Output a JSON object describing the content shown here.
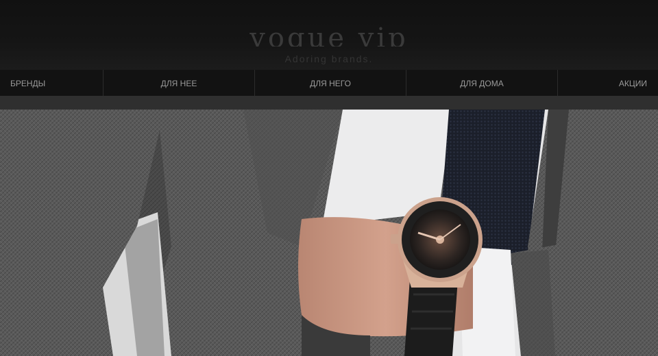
{
  "header": {
    "logo_text": "vogue vip",
    "tagline": "Adoring brands."
  },
  "nav": {
    "items": [
      {
        "id": "brands",
        "label": "БРЕНДЫ"
      },
      {
        "id": "for-her",
        "label": "ДЛЯ НЕЕ"
      },
      {
        "id": "for-him",
        "label": "ДЛЯ НЕГО"
      },
      {
        "id": "for-home",
        "label": "ДЛЯ ДОМА"
      },
      {
        "id": "sales",
        "label": "АКЦИИ"
      }
    ]
  },
  "hero": {
    "colors": {
      "suit": "#585858",
      "suit_dark": "#3a3a3a",
      "shirt": "#e9e9ea",
      "tie": "#1b1f2a",
      "skin": "#c69480",
      "watch_gold": "#d8b29a",
      "watch_strap": "#1c1c1c"
    }
  }
}
